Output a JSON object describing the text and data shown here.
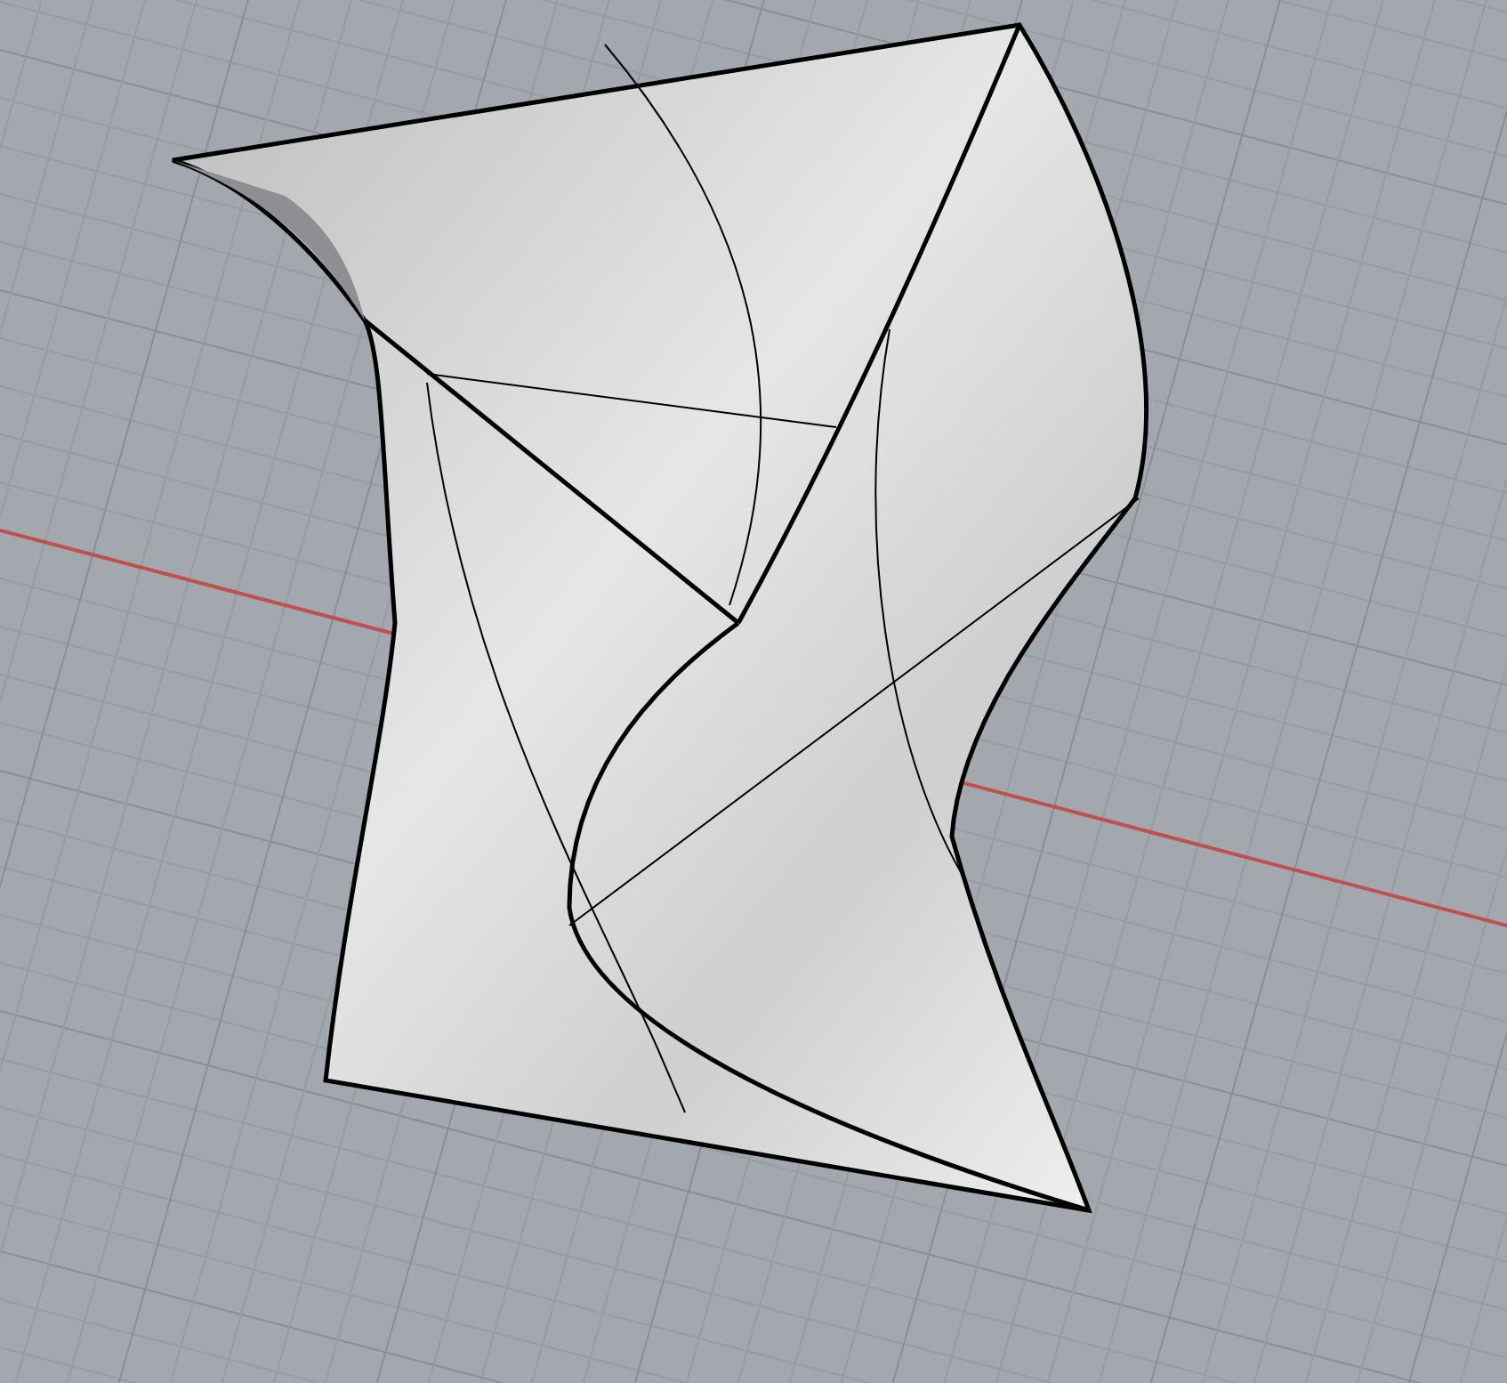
{
  "viewport": {
    "grid": true,
    "x_axis": true
  }
}
